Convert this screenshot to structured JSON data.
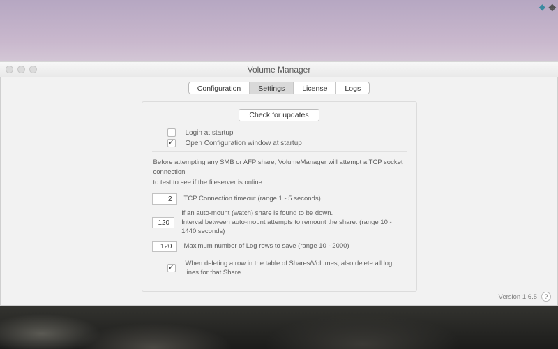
{
  "menubar": {
    "diamond_icon": "◆",
    "notif_icon": "❖"
  },
  "window": {
    "title": "Volume Manager",
    "tabs": [
      "Configuration",
      "Settings",
      "License",
      "Logs"
    ],
    "selected_tab_index": 1
  },
  "settings": {
    "check_updates_label": "Check for updates",
    "login_at_startup": {
      "checked": false,
      "label": "Login at startup"
    },
    "open_config_at_startup": {
      "checked": true,
      "label": "Open Configuration window at startup"
    },
    "tcp_desc_line1": "Before attempting any SMB or AFP share, VolumeManager will attempt a TCP socket connection",
    "tcp_desc_line2": "to test to see if the fileserver is online.",
    "tcp_timeout": {
      "value": "2",
      "label": "TCP Connection timeout (range 1 - 5 seconds)"
    },
    "remount_interval": {
      "value": "120",
      "label_line1": "If an auto-mount (watch) share is found to be down.",
      "label_line2": "Interval between auto-mount attempts to remount the share:  (range 10 - 1440 seconds)"
    },
    "max_log_rows": {
      "value": "120",
      "label": "Maximum number of Log rows to save (range 10 - 2000)"
    },
    "delete_logs_with_share": {
      "checked": true,
      "label": "When deleting a row in the table of Shares/Volumes, also delete all log lines for that Share"
    }
  },
  "footer": {
    "version": "Version 1.6.5",
    "help": "?"
  }
}
